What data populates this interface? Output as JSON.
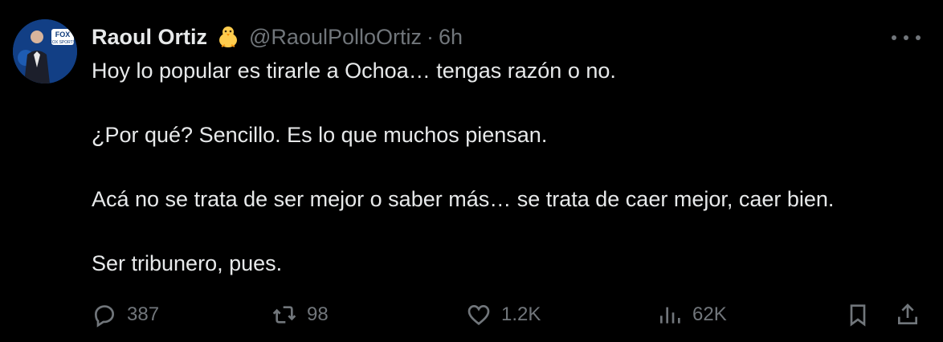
{
  "author": {
    "name": "Raoul Ortiz",
    "emoji": "baby-chick",
    "handle": "@RaoulPolloOrtiz",
    "separator": "·",
    "time": "6h",
    "avatar_badge": "FOX SPORTS"
  },
  "tweet": {
    "paragraphs": [
      "Hoy lo popular es tirarle a Ochoa… tengas razón o no.",
      "¿Por qué? Sencillo. Es lo que muchos piensan.",
      "Acá no se trata de ser mejor o saber más… se trata de caer mejor, caer bien.",
      "Ser tribunero, pues."
    ]
  },
  "actions": {
    "replies": "387",
    "retweets": "98",
    "likes": "1.2K",
    "views": "62K"
  },
  "icons": {
    "more": "more-icon",
    "reply": "reply-icon",
    "retweet": "retweet-icon",
    "like": "heart-icon",
    "views": "views-icon",
    "bookmark": "bookmark-icon",
    "share": "share-icon"
  },
  "colors": {
    "background": "#000000",
    "text": "#e7e9ea",
    "muted": "#71767b",
    "chick": "#ffcc4d"
  }
}
